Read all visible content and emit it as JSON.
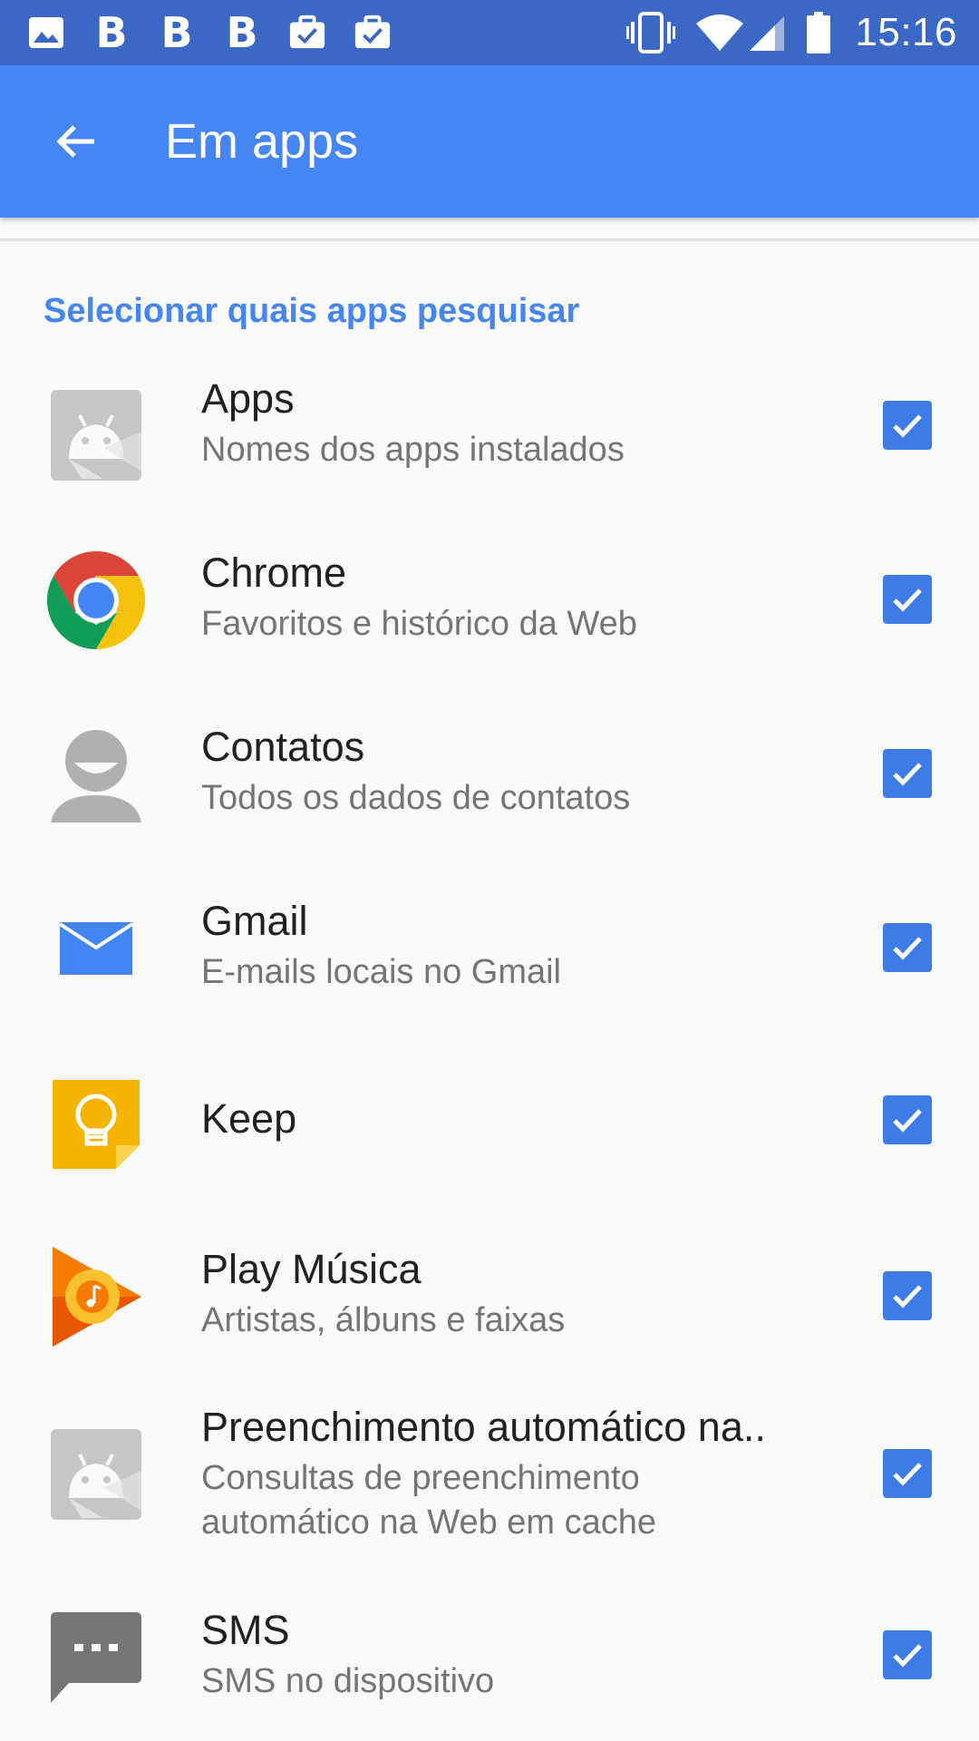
{
  "status_bar": {
    "time": "15:16",
    "notifications": [
      "image-icon",
      "b",
      "b",
      "b",
      "briefcase-check-icon",
      "briefcase-check-icon"
    ],
    "b_letter": "B"
  },
  "app_bar": {
    "title": "Em apps",
    "color": "#4586f4"
  },
  "section": {
    "header": "Selecionar quais apps pesquisar"
  },
  "items": [
    {
      "title": "Apps",
      "subtitle": "Nomes dos apps instalados",
      "icon": "android-apps-icon",
      "checked": true
    },
    {
      "title": "Chrome",
      "subtitle": "Favoritos e histórico da Web",
      "icon": "chrome-icon",
      "checked": true
    },
    {
      "title": "Contatos",
      "subtitle": "Todos os dados de contatos",
      "icon": "contacts-icon",
      "checked": true
    },
    {
      "title": "Gmail",
      "subtitle": "E-mails locais no Gmail",
      "icon": "mail-icon",
      "checked": true
    },
    {
      "title": "Keep",
      "subtitle": "",
      "icon": "keep-icon",
      "checked": true
    },
    {
      "title": "Play Música",
      "subtitle": "Artistas, álbuns e faixas",
      "icon": "play-music-icon",
      "checked": true
    },
    {
      "title": "Preenchimento automático na..",
      "subtitle": "Consultas de preenchimento automático na Web em cache",
      "icon": "android-autofill-icon",
      "checked": true
    },
    {
      "title": "SMS",
      "subtitle": "SMS no dispositivo",
      "icon": "sms-icon",
      "checked": true
    }
  ]
}
